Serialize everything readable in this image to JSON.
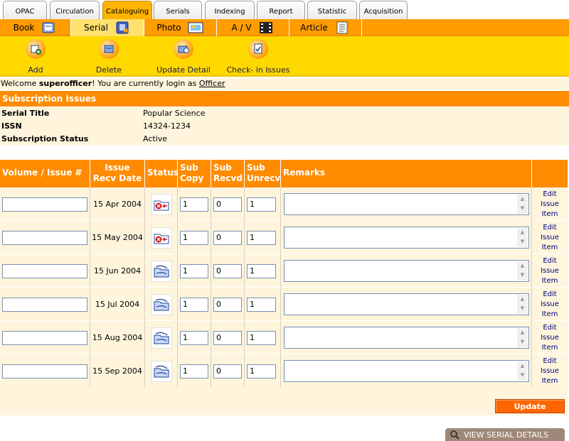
{
  "top_tabs": [
    {
      "label": "OPAC",
      "active": false
    },
    {
      "label": "Circulation",
      "active": false
    },
    {
      "label": "Cataloguing",
      "active": true
    },
    {
      "label": "Serials",
      "active": false
    },
    {
      "label": "Indexing",
      "active": false
    },
    {
      "label": "Report",
      "active": false
    },
    {
      "label": "Statistic",
      "active": false
    },
    {
      "label": "Acquisition",
      "active": false
    }
  ],
  "sub_nav": [
    {
      "label": "Book",
      "icon": "book-icon",
      "active": false
    },
    {
      "label": "Serial",
      "icon": "serial-icon",
      "active": true
    },
    {
      "label": "Photo",
      "icon": "photo-icon",
      "active": false
    },
    {
      "label": "A / V",
      "icon": "film-icon",
      "active": false
    },
    {
      "label": "Article",
      "icon": "article-icon",
      "active": false
    }
  ],
  "toolbar": [
    {
      "label": "Add",
      "icon": "add-icon"
    },
    {
      "label": "Delete",
      "icon": "delete-icon"
    },
    {
      "label": "Update Detail",
      "icon": "update-icon"
    },
    {
      "label": "Check- in Issues",
      "icon": "checkin-icon"
    }
  ],
  "welcome": {
    "prefix": "Welcome ",
    "user": "superofficer",
    "middle": "! You are currently login as ",
    "role": "Officer"
  },
  "section_title": "Subscription Issues",
  "info": [
    {
      "label": "Serial Title",
      "value": "Popular Science"
    },
    {
      "label": "ISSN",
      "value": "14324-1234"
    },
    {
      "label": "Subscription Status",
      "value": "Active"
    }
  ],
  "columns": {
    "volume": "Volume / Issue #",
    "recv_line1": "Issue",
    "recv_line2": "Recv Date",
    "status": "Status",
    "copy_line1": "Sub",
    "copy_line2": "Copy",
    "recvd_line1": "Sub",
    "recvd_line2": "Recvd",
    "unrecv_line1": "Sub",
    "unrecv_line2": "Unrecv",
    "remarks": "Remarks"
  },
  "edit_link": {
    "line1": "Edit",
    "line2": "Issue",
    "line3": "Item"
  },
  "rows": [
    {
      "volume": "",
      "date": "15 Apr 2004",
      "status": "not-received",
      "copy": "1",
      "recvd": "0",
      "unrecv": "1",
      "remarks": ""
    },
    {
      "volume": "",
      "date": "15 May 2004",
      "status": "not-received",
      "copy": "1",
      "recvd": "0",
      "unrecv": "1",
      "remarks": ""
    },
    {
      "volume": "",
      "date": "15 Jun 2004",
      "status": "pending",
      "copy": "1",
      "recvd": "0",
      "unrecv": "1",
      "remarks": ""
    },
    {
      "volume": "",
      "date": "15 Jul 2004",
      "status": "pending",
      "copy": "1",
      "recvd": "0",
      "unrecv": "1",
      "remarks": ""
    },
    {
      "volume": "",
      "date": "15 Aug 2004",
      "status": "pending",
      "copy": "1",
      "recvd": "0",
      "unrecv": "1",
      "remarks": ""
    },
    {
      "volume": "",
      "date": "15 Sep 2004",
      "status": "pending",
      "copy": "1",
      "recvd": "0",
      "unrecv": "1",
      "remarks": ""
    }
  ],
  "update_label": "Update",
  "view_serial_label": "VIEW SERIAL DETAILS",
  "colors": {
    "accent": "#ff8c00",
    "toolbar": "#ffd800",
    "panel": "#fef5dc",
    "button": "#ff6600"
  }
}
